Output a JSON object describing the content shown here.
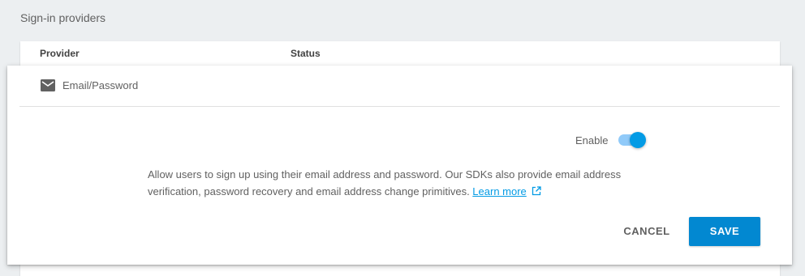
{
  "section": {
    "title": "Sign-in providers"
  },
  "table": {
    "columns": [
      "Provider",
      "Status"
    ]
  },
  "provider": {
    "name": "Email/Password",
    "icon": "mail-icon"
  },
  "config": {
    "enable_label": "Enable",
    "enabled": true,
    "description": "Allow users to sign up using their email address and password. Our SDKs also provide email address verification, password recovery and email address change primitives.",
    "learn_more": "Learn more",
    "link_icon": "external-link-icon"
  },
  "actions": {
    "cancel_label": "CANCEL",
    "save_label": "SAVE"
  },
  "colors": {
    "accent": "#039be5",
    "save_button": "#0288d1",
    "toggle_track": "#90caf9",
    "background": "#eceff1"
  }
}
